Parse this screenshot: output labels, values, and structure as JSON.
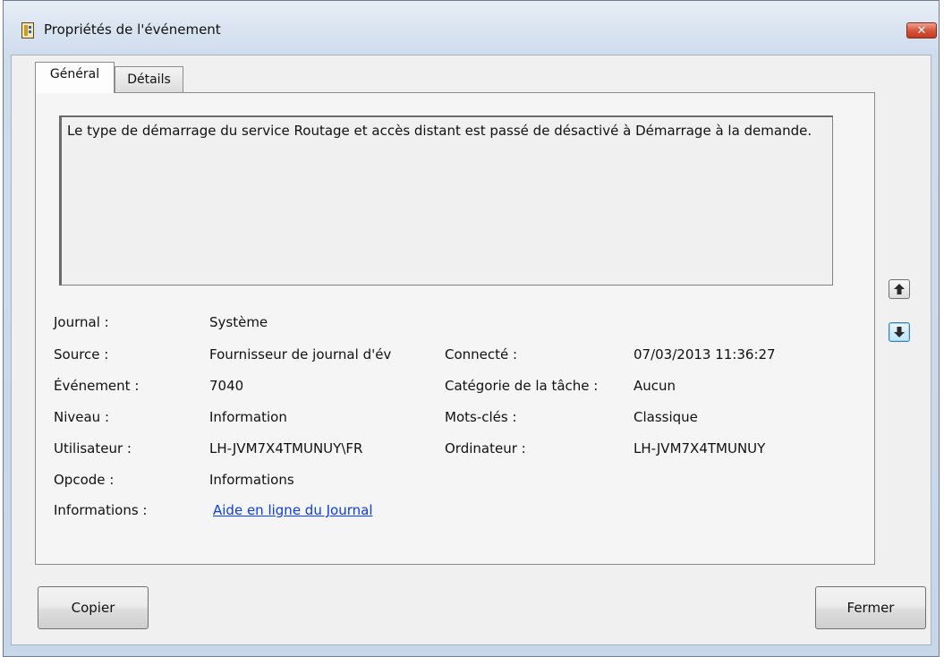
{
  "window": {
    "title": "Propriétés de l'événement",
    "close_glyph": "✕"
  },
  "tabs": [
    {
      "label": "Général",
      "active": true
    },
    {
      "label": "Détails",
      "active": false
    }
  ],
  "message": "Le type de démarrage du service Routage et accès distant est passé de désactivé à Démarrage à la demande.",
  "fields_left": [
    {
      "label": "Journal :",
      "value": "Système"
    },
    {
      "label": "Source :",
      "value": "Fournisseur de journal d'év"
    },
    {
      "label": "Événement :",
      "value": "7040"
    },
    {
      "label": "Niveau :",
      "value": "Information"
    },
    {
      "label": "Utilisateur :",
      "value": "LH-JVM7X4TMUNUY\\FR"
    },
    {
      "label": "Opcode :",
      "value": "Informations"
    },
    {
      "label": "Informations :",
      "value": "Aide en ligne du Journal"
    }
  ],
  "fields_right": [
    {
      "label": "Connecté :",
      "value": "07/03/2013 11:36:27"
    },
    {
      "label": "Catégorie de la tâche :",
      "value": "Aucun"
    },
    {
      "label": "Mots-clés :",
      "value": "Classique"
    },
    {
      "label": "Ordinateur :",
      "value": "LH-JVM7X4TMUNUY"
    }
  ],
  "nav": {
    "up_icon": "arrow-up-icon",
    "down_icon": "arrow-down-icon"
  },
  "buttons": {
    "copy": "Copier",
    "close": "Fermer"
  },
  "colors": {
    "link": "#0a3cf0",
    "close_button": "#c23b22",
    "window_frame": "#cfdcec"
  }
}
